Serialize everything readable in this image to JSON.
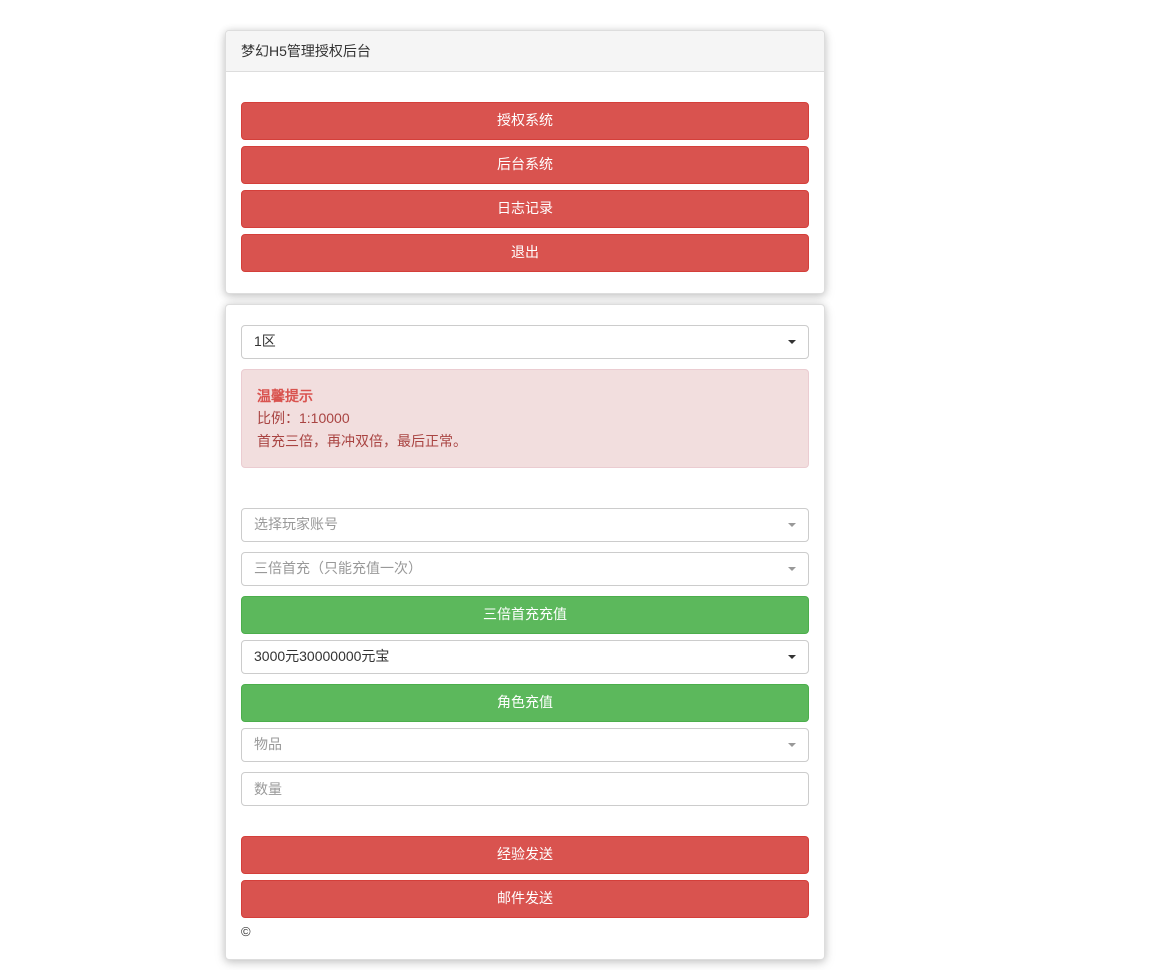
{
  "header": {
    "title": "梦幻H5管理授权后台"
  },
  "nav": {
    "auth_system": "授权系统",
    "backend_system": "后台系统",
    "log_record": "日志记录",
    "logout": "退出"
  },
  "zone_select": {
    "value": "1区"
  },
  "alert": {
    "title": "温馨提示",
    "line1": "比例：1:10000",
    "line2": "首充三倍，再冲双倍，最后正常。"
  },
  "player_select": {
    "placeholder": "选择玩家账号"
  },
  "first_charge_select": {
    "placeholder": "三倍首充（只能充值一次）"
  },
  "buttons": {
    "triple_first_charge": "三倍首充充值",
    "role_charge": "角色充值",
    "exp_send": "经验发送",
    "mail_send": "邮件发送"
  },
  "amount_select": {
    "value": "3000元30000000元宝"
  },
  "item_select": {
    "placeholder": "物品"
  },
  "quantity_input": {
    "placeholder": "数量"
  },
  "footer": {
    "copyright": "©"
  }
}
